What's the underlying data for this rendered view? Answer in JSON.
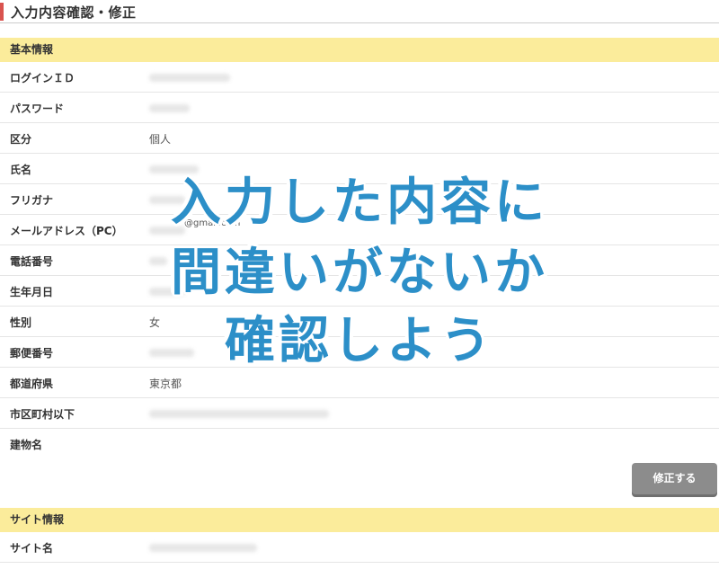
{
  "header": {
    "title": "入力内容確認・修正"
  },
  "basic_section": {
    "title": "基本情報",
    "rows": [
      {
        "label": "ログインＩＤ",
        "value": "",
        "masked": true
      },
      {
        "label": "パスワード",
        "value": "",
        "masked": true
      },
      {
        "label": "区分",
        "value": "個人",
        "masked": false
      },
      {
        "label": "氏名",
        "value": "",
        "masked": true
      },
      {
        "label": "フリガナ",
        "value": "",
        "masked": true
      },
      {
        "label": "メールアドレス（PC）",
        "value": "",
        "masked": true,
        "note": "@gmail.com"
      },
      {
        "label": "電話番号",
        "value": "",
        "masked": true
      },
      {
        "label": "生年月日",
        "value": "",
        "masked": true
      },
      {
        "label": "性別",
        "value": "女",
        "masked": false
      },
      {
        "label": "郵便番号",
        "value": "",
        "masked": true
      },
      {
        "label": "都道府県",
        "value": "東京都",
        "masked": false
      },
      {
        "label": "市区町村以下",
        "value": "",
        "masked": true
      },
      {
        "label": "建物名",
        "value": "",
        "masked": false
      }
    ],
    "edit_button_label": "修正する"
  },
  "site_section": {
    "title": "サイト情報",
    "rows": [
      {
        "label": "サイト名",
        "value": "",
        "masked": true
      }
    ]
  },
  "overlay": {
    "lines": [
      "入力した内容に",
      "間違いがないか",
      "確認しよう"
    ],
    "color": "#2c8fc8"
  },
  "colors": {
    "section_bg": "#fbec9b",
    "accent": "#d9534f",
    "button_bg": "#8c8c8c"
  }
}
